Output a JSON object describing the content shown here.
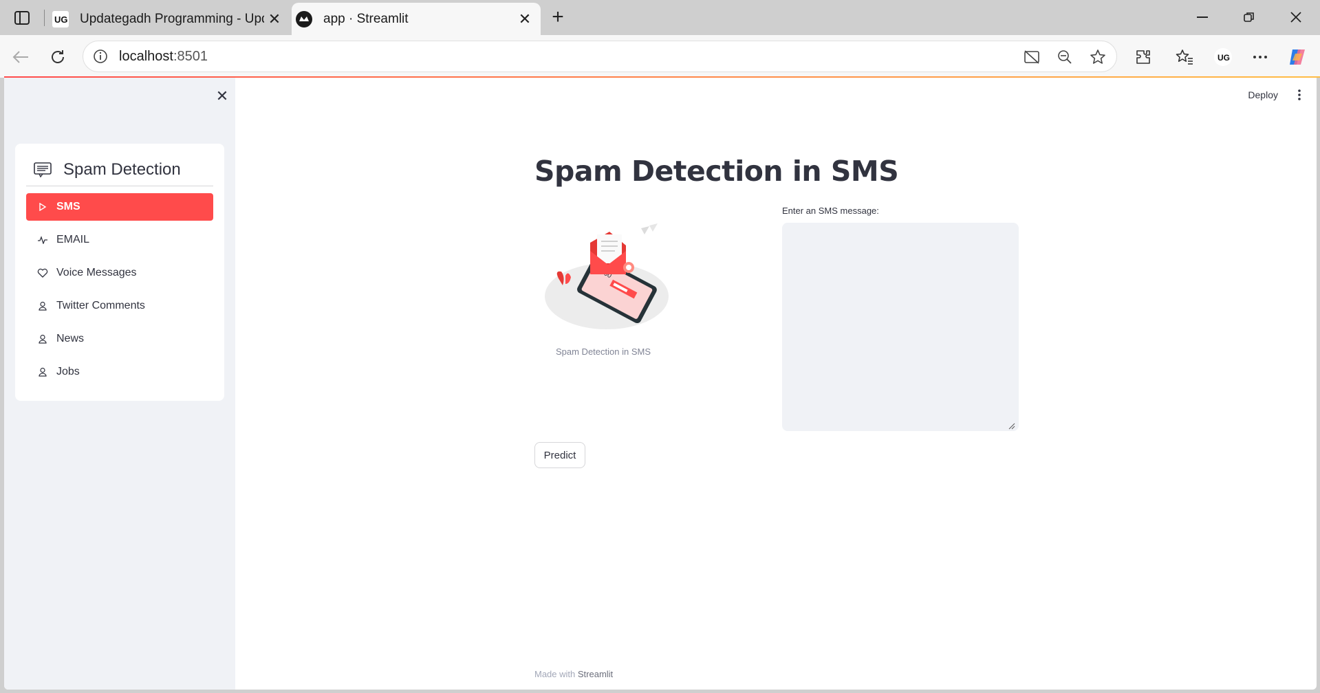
{
  "browser": {
    "tabs": [
      {
        "title": "Updategadh Programming - Upd",
        "active": false
      },
      {
        "title": "app · Streamlit",
        "active": true
      }
    ],
    "url_host": "localhost",
    "url_port": ":8501"
  },
  "header": {
    "deploy_label": "Deploy"
  },
  "sidebar": {
    "menu_title": "Spam Detection",
    "items": [
      {
        "label": "SMS",
        "icon": "play-icon",
        "active": true
      },
      {
        "label": "EMAIL",
        "icon": "activity-icon",
        "active": false
      },
      {
        "label": "Voice Messages",
        "icon": "heart-icon",
        "active": false
      },
      {
        "label": "Twitter Comments",
        "icon": "person-icon",
        "active": false
      },
      {
        "label": "News",
        "icon": "person-icon",
        "active": false
      },
      {
        "label": "Jobs",
        "icon": "person-icon",
        "active": false
      }
    ]
  },
  "main": {
    "title": "Spam Detection in SMS",
    "image_caption": "Spam Detection in SMS",
    "textarea_label": "Enter an SMS message:",
    "textarea_value": "",
    "predict_label": "Predict"
  },
  "footer": {
    "prefix": "Made with ",
    "brand": "Streamlit"
  },
  "colors": {
    "accent": "#ff4b4b",
    "sidebar_bg": "#f0f2f6",
    "text": "#31333f"
  }
}
